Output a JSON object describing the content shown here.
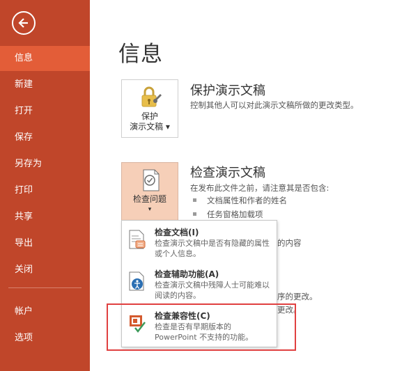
{
  "sidebar": {
    "items": [
      {
        "label": "信息",
        "active": true
      },
      {
        "label": "新建"
      },
      {
        "label": "打开"
      },
      {
        "label": "保存"
      },
      {
        "label": "另存为"
      },
      {
        "label": "打印"
      },
      {
        "label": "共享"
      },
      {
        "label": "导出"
      },
      {
        "label": "关闭"
      }
    ],
    "bottom_items": [
      {
        "label": "帐户"
      },
      {
        "label": "选项"
      }
    ],
    "back_icon": "back-arrow-icon"
  },
  "page_title": "信息",
  "protect": {
    "button_line1": "保护",
    "button_line2": "演示文稿 ▾",
    "title": "保护演示文稿",
    "desc": "控制其他人可以对此演示文稿所做的更改类型。",
    "icon": "lock-icon"
  },
  "inspect": {
    "button_line1": "检查问题",
    "button_line2": "▾",
    "title": "检查演示文稿",
    "desc": "在发布此文件之前，请注意其是否包含:",
    "bullets": [
      "文档属性和作者的姓名",
      "任务窗格加载项"
    ],
    "partial_text_1": "的内容",
    "partial_text_2": "序的更改。",
    "partial_text_3": "更改。",
    "icon": "inspect-document-icon"
  },
  "dropdown": {
    "items": [
      {
        "title": "检查文档(I)",
        "desc": "检查演示文稿中是否有隐藏的属性或个人信息。",
        "icon": "document-inspector-icon"
      },
      {
        "title": "检查辅助功能(A)",
        "desc": "检查演示文稿中残障人士可能难以阅读的内容。",
        "icon": "accessibility-checker-icon"
      },
      {
        "title": "检查兼容性(C)",
        "desc": "检查是否有早期版本的 PowerPoint 不支持的功能。",
        "icon": "compatibility-checker-icon"
      }
    ]
  },
  "colors": {
    "sidebar": "#c0462a",
    "sidebar_active": "#e35d38",
    "highlight": "#e04040"
  }
}
